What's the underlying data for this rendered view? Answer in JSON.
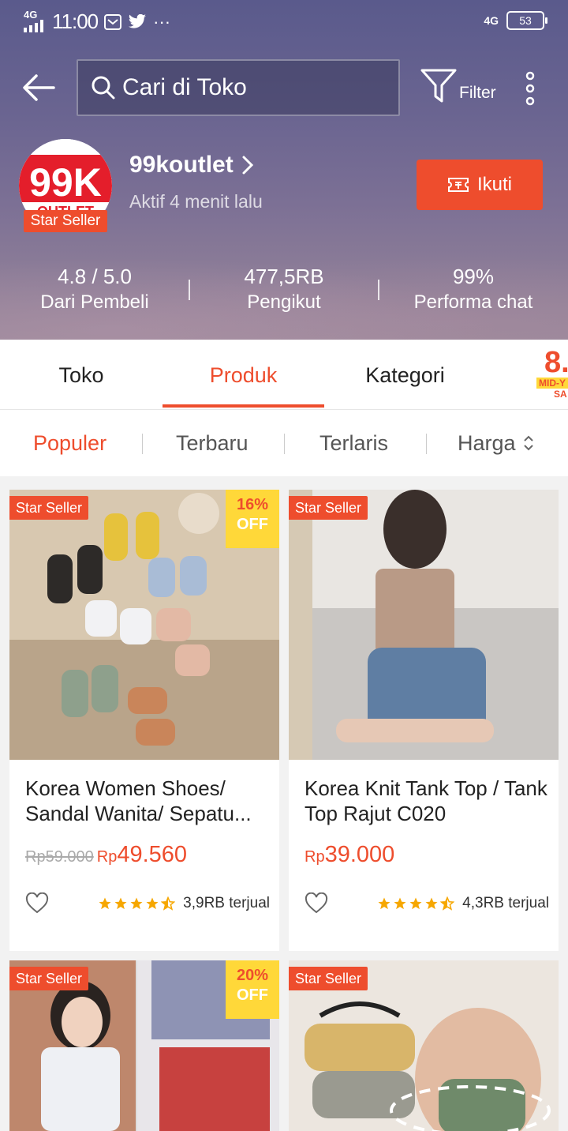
{
  "status": {
    "time": "11:00",
    "network_left": "4G",
    "network_right": "4G",
    "battery": "53",
    "more": "···"
  },
  "search": {
    "placeholder": "Cari di Toko"
  },
  "toolbar": {
    "filter_label": "Filter"
  },
  "shop": {
    "name": "99koutlet",
    "active": "Aktif 4 menit lalu",
    "badge": "Star Seller",
    "follow_label": "Ikuti",
    "logo_text_top": "99K",
    "logo_text_bottom": "OUTLET"
  },
  "stats": [
    {
      "value": "4.8 / 5.0",
      "label": "Dari Pembeli"
    },
    {
      "value": "477,5RB",
      "label": "Pengikut"
    },
    {
      "value": "99%",
      "label": "Performa chat"
    }
  ],
  "tabs": [
    {
      "label": "Toko"
    },
    {
      "label": "Produk"
    },
    {
      "label": "Kategori"
    }
  ],
  "promo": {
    "top": "8.",
    "mid": "MID-Y",
    "bottom": "SA"
  },
  "sorts": [
    {
      "label": "Populer"
    },
    {
      "label": "Terbaru"
    },
    {
      "label": "Terlaris"
    },
    {
      "label": "Harga"
    }
  ],
  "products": [
    {
      "badge": "Star Seller",
      "discount_pct": "16%",
      "discount_label": "OFF",
      "title": "Korea Women Shoes/ Sandal Wanita/ Sepatu...",
      "old_price": "Rp59.000",
      "price_prefix": "Rp",
      "price": "49.560",
      "rating": 4.5,
      "sold": "3,9RB terjual"
    },
    {
      "badge": "Star Seller",
      "title": "Korea Knit Tank Top / Tank Top Rajut C020",
      "price_prefix": "Rp",
      "price": "39.000",
      "rating": 4.5,
      "sold": "4,3RB terjual"
    },
    {
      "badge": "Star Seller",
      "discount_pct": "20%",
      "discount_label": "OFF"
    },
    {
      "badge": "Star Seller"
    }
  ],
  "colors": {
    "accent": "#ee4d2d",
    "discount_bg": "#ffd839",
    "star": "#f6a700"
  }
}
